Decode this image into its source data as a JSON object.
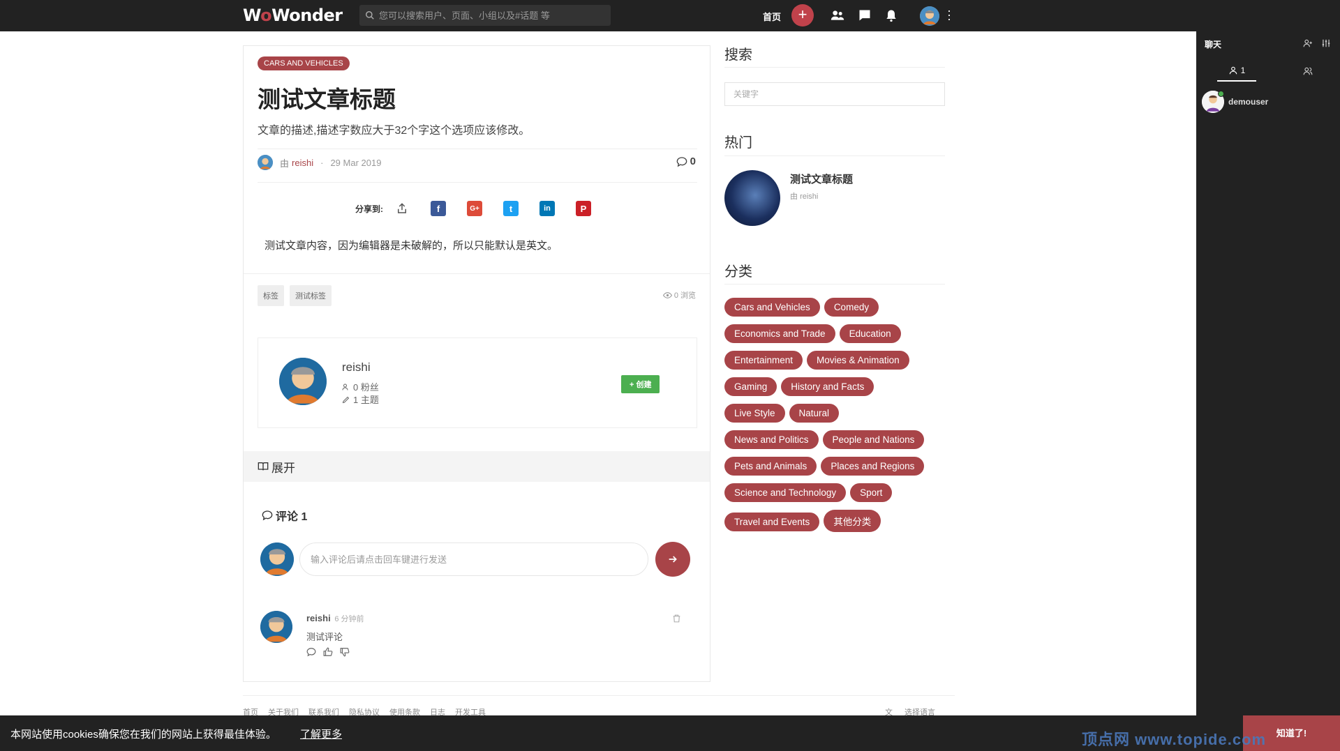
{
  "header": {
    "logo": "WoWonder",
    "search_placeholder": "您可以搜索用户、页面、小组以及#话题 等",
    "home": "首页",
    "icons": [
      "plus-icon",
      "friends-icon",
      "messages-icon",
      "notifications-icon",
      "more-icon"
    ]
  },
  "chat": {
    "title": "聊天",
    "online_count": "1",
    "user": "demouser"
  },
  "article": {
    "category": "CARS AND VEHICLES",
    "title": "测试文章标题",
    "description": "文章的描述,描述字数应大于32个字这个选项应该修改。",
    "by": "由",
    "author": "reishi",
    "date": "29 Mar 2019",
    "comment_count": "0",
    "share_label": "分享到:",
    "content": "测试文章内容，因为编辑器是未破解的，所以只能默认是英文。",
    "tags": [
      "标签",
      "测试标签"
    ],
    "views": "0 浏览"
  },
  "author_box": {
    "name": "reishi",
    "followers": "0 粉丝",
    "topics": "1 主题",
    "follow": "+ 创建"
  },
  "expand": "展开",
  "comments": {
    "title": "评论 1",
    "input_placeholder": "输入评论后请点击回车键进行发送",
    "items": [
      {
        "author": "reishi",
        "time": "6 分钟前",
        "text": "测试评论"
      }
    ]
  },
  "sidebar": {
    "search_title": "搜索",
    "search_placeholder": "关键字",
    "trending_title": "热门",
    "trending": {
      "title": "测试文章标题",
      "by": "由",
      "author": "reishi"
    },
    "categories_title": "分类",
    "categories": [
      "Cars and Vehicles",
      "Comedy",
      "Economics and Trade",
      "Education",
      "Entertainment",
      "Movies & Animation",
      "Gaming",
      "History and Facts",
      "Live Style",
      "Natural",
      "News and Politics",
      "People and Nations",
      "Pets and Animals",
      "Places and Regions",
      "Science and Technology",
      "Sport",
      "Travel and Events",
      "其他分类"
    ]
  },
  "footer": {
    "links": [
      "首页",
      "关于我们",
      "联系我们",
      "隐私协议",
      "使用条款",
      "日志",
      "开发工具"
    ],
    "language": "选择语言"
  },
  "cookie": {
    "message": "本网站使用cookies确保您在我们的网站上获得最佳体验。",
    "learn_more": "了解更多",
    "accept": "知道了!"
  },
  "watermark": "顶点网 www.topide.com",
  "colors": {
    "accent": "#a84448",
    "topbar": "#222222",
    "follow": "#4caf50"
  }
}
